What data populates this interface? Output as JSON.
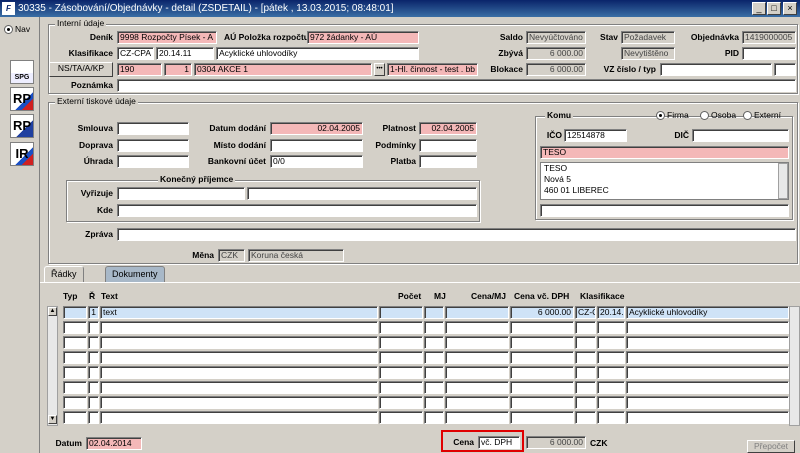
{
  "window": {
    "title": "30335 - Zásobování/Objednávky - detail (ZSDETAIL) - [pátek , 13.03.2015; 08:48:01]",
    "app_icon": "F",
    "minimize": "_",
    "maximize": "□",
    "close": "×"
  },
  "sidebar": {
    "nav_label": "Nav",
    "icons": [
      {
        "name": "spg-icon",
        "label": "SPG"
      },
      {
        "name": "rp-cz-icon",
        "label": "RP"
      },
      {
        "name": "rp-eu-icon",
        "label": "RP"
      },
      {
        "name": "ir-icon",
        "label": "IR"
      }
    ]
  },
  "header": {
    "group_internal": "Interní údaje",
    "denik_label": "Deník",
    "denik_value": "9998 Rozpočty Písek - A",
    "au_label": "AÚ Položka rozpočtu",
    "au_value": "972 žádanky - AÚ",
    "saldo_label": "Saldo",
    "saldo_value": "Nevyúčtováno",
    "stav_label": "Stav",
    "stav_value": "Požadavek",
    "objednavka_label": "Objednávka",
    "objednavka_value": "1419000005",
    "klasifikace_label": "Klasifikace",
    "klas_code": "CZ-CPA",
    "klas_num": "20.14.11",
    "klas_text": "Acyklické uhlovodíky",
    "zbyva_label": "Zbývá",
    "zbyva_value": "6 000.00",
    "status2": "Nevytištěno",
    "pid_label": "PID",
    "pid_value": "",
    "ns_button": "NS/TA/A/KP",
    "ns1": "190",
    "ns2": "1",
    "ns3": "0304 AKCE 1",
    "dots": "•••",
    "ns4": "1-Hl. činnost - test . bb",
    "blokace_label": "Blokace",
    "blokace_value": "6 000.00",
    "vz_label": "VZ číslo / typ",
    "vz_value": "",
    "vz_type": "",
    "poznamka_label": "Poznámka",
    "poznamka_value": ""
  },
  "external": {
    "group_label": "Externí tiskové údaje",
    "smlouva_label": "Smlouva",
    "smlouva_value": "",
    "doprava_label": "Doprava",
    "doprava_value": "",
    "uhrada_label": "Úhrada",
    "uhrada_value": "",
    "datum_dodani_label": "Datum dodání",
    "datum_dodani_value": "02.04.2005",
    "misto_label": "Místo dodání",
    "misto_value": "",
    "ucet_label": "Bankovní účet",
    "ucet_value": "0/0",
    "platnost_label": "Platnost",
    "platnost_value": "02.04.2005",
    "podminky_label": "Podmínky",
    "podminky_value": "",
    "platba_label": "Platba",
    "platba_value": "",
    "konecny_label": "Konečný příjemce",
    "vyrizuje_label": "Vyřizuje",
    "vyrizuje_value": "",
    "vyrizuje_value2": "",
    "kde_label": "Kde",
    "kde_value": "",
    "zprava_label": "Zpráva",
    "zprava_value": "",
    "mena_label": "Měna",
    "mena_code": "CZK",
    "mena_name": "Koruna česká"
  },
  "komu": {
    "label": "Komu",
    "firma": "Firma",
    "osoba": "Osoba",
    "externi": "Externí",
    "ico_label": "IČO",
    "ico_value": "12514878",
    "dic_label": "DIČ",
    "dic_value": "",
    "name": "TESO",
    "addr1": "TESO",
    "addr2": "Nová 5",
    "addr3": "460 01  LIBEREC",
    "extra": ""
  },
  "tabs": [
    {
      "label": "Řádky"
    },
    {
      "label": "Dokumenty"
    }
  ],
  "grid": {
    "headers": {
      "typ": "Typ",
      "r": "Ř",
      "text": "Text",
      "pocet": "Počet",
      "mj": "MJ",
      "cena_mj": "Cena/MJ",
      "cena_dph": "Cena vč. DPH",
      "klasifikace": "Klasifikace"
    },
    "rows": [
      {
        "typ": "",
        "r": "1",
        "text": "text",
        "pocet": "",
        "mj": "",
        "cena_mj": "",
        "cena_dph": "6 000.00",
        "klas1": "CZ-C",
        "klas2": "20.14.",
        "klas3": "Acyklické uhlovodíky"
      }
    ]
  },
  "footer": {
    "datum_label": "Datum",
    "datum_value": "02.04.2014",
    "cena_label": "Cena",
    "cena_type": "vč. DPH",
    "cena_value": "6 000.00",
    "currency": "CZK",
    "prepocet": "Přepočet"
  },
  "colors": {
    "required": "#f4b8b8",
    "selected_row": "#cfe3f7",
    "highlight_box": "#e00000"
  }
}
